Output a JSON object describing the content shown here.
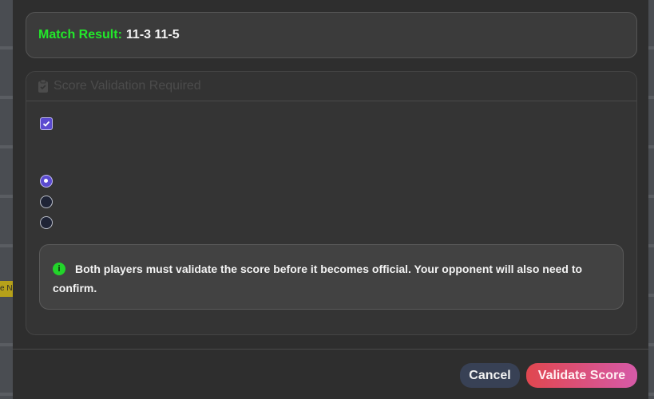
{
  "background": {
    "badge_text": "e N"
  },
  "match_result": {
    "label": "Match Result:",
    "score": "11-3 11-5"
  },
  "validation": {
    "title": "Score Validation Required",
    "icon": "clipboard-check-icon",
    "checkbox_checked": true,
    "radio_options": [
      {
        "selected": true
      },
      {
        "selected": false
      },
      {
        "selected": false
      }
    ],
    "info_icon": "info-icon",
    "info_glyph": "i",
    "info_text": "Both players must validate the score before it becomes official. Your opponent will also need to confirm."
  },
  "footer": {
    "cancel_label": "Cancel",
    "validate_label": "Validate Score"
  },
  "colors": {
    "accent_green": "#22e82a",
    "accent_purple": "#5b4bd0",
    "validate_gradient_start": "#e0474f",
    "validate_gradient_end": "#d65aa8",
    "cancel_bg": "#384155"
  }
}
